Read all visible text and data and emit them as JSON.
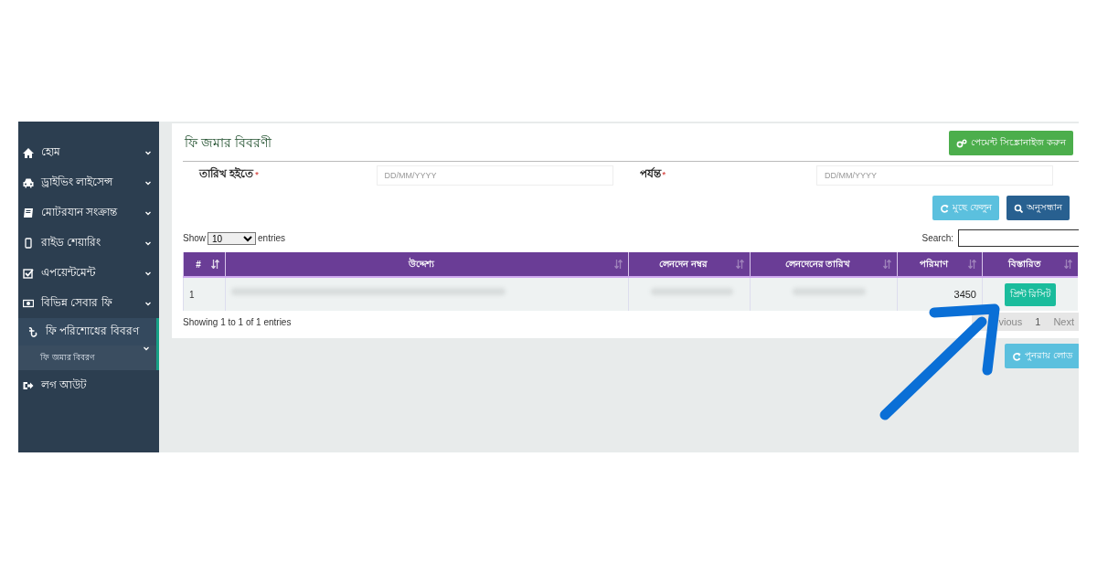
{
  "sidebar": {
    "items": [
      {
        "label": "হোম",
        "kind": "home",
        "expanded": false,
        "selected": false
      },
      {
        "label": "ড্রাইভিং লাইসেন্স",
        "kind": "car",
        "expanded": false,
        "selected": false
      },
      {
        "label": "মোটরযান সংক্রান্ত",
        "kind": "book",
        "expanded": false,
        "selected": false
      },
      {
        "label": "রাইড শেয়ারিং",
        "kind": "phone",
        "expanded": false,
        "selected": false
      },
      {
        "label": "এপয়েন্টমেন্ট",
        "kind": "check",
        "expanded": false,
        "selected": false
      },
      {
        "label": "বিভিন্ন সেবার ফি",
        "kind": "money",
        "expanded": false,
        "selected": false
      },
      {
        "label": "ফি পরিশোধের বিবরণ",
        "kind": "taka",
        "expanded": true,
        "selected": true,
        "children": [
          {
            "label": "ফি জমার বিবরণ",
            "selected": true
          }
        ]
      },
      {
        "label": "লগ আউট",
        "kind": "logout",
        "selected": false
      }
    ]
  },
  "page": {
    "title": "ফি জমার বিবরণী",
    "sync_button": "পেমেন্ট সিঙ্ক্রোনাইজ করুন"
  },
  "filters": [
    {
      "label": "তারিখ হইতে",
      "required_mark": "*",
      "placeholder": "DD/MM/YYYY"
    },
    {
      "label": "পর্যন্ত",
      "required_mark": "*",
      "placeholder": "DD/MM/YYYY"
    }
  ],
  "filter_buttons": [
    {
      "label": "মুছে ফেলুন",
      "kind": "reset"
    },
    {
      "label": "অনুসন্ধান",
      "kind": "search"
    }
  ],
  "table": {
    "length_prefix": "Show",
    "page_length": "10",
    "length_suffix": "entries",
    "search_label": "Search:",
    "columns": [
      {
        "label": "#",
        "sorted": true
      },
      {
        "label": "উদ্দেশ্য",
        "sorted": false
      },
      {
        "label": "লেনদেন নম্বর",
        "sorted": false
      },
      {
        "label": "লেনদেনের তারিখ",
        "sorted": false
      },
      {
        "label": "পরিমাণ",
        "sorted": false
      },
      {
        "label": "বিস্তারিত",
        "sorted": false
      }
    ],
    "rows": [
      [
        {
          "kind": "text",
          "text": "1"
        },
        {
          "kind": "blurred"
        },
        {
          "kind": "blurred"
        },
        {
          "kind": "blurred"
        },
        {
          "kind": "amount",
          "text": "3450"
        },
        {
          "kind": "button",
          "text": "প্রিন্ট রিসিট"
        }
      ]
    ],
    "info": "Showing 1 to 1 of 1 entries",
    "pagination": [
      {
        "label": "vious",
        "selected": false
      },
      {
        "label": "1",
        "selected": true
      },
      {
        "label": "Next",
        "selected": false
      }
    ]
  },
  "reload_button": "পুনরায় লোড",
  "annotation": {
    "kind": "arrow"
  }
}
